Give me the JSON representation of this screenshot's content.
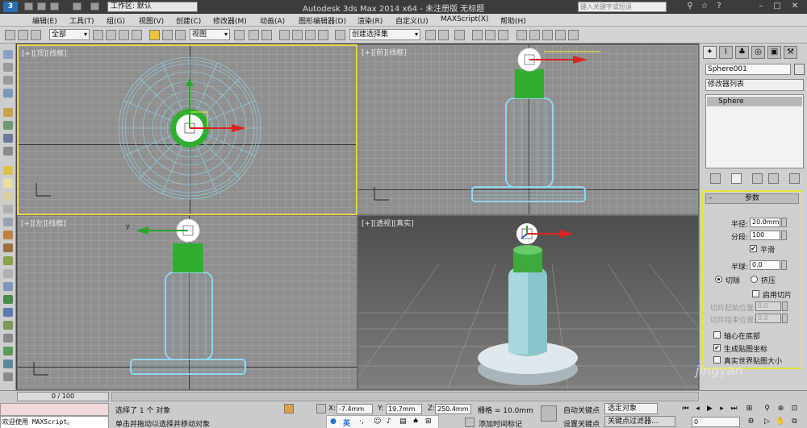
{
  "titlebar": {
    "workspace": "工作区: 默认",
    "title": "Autodesk 3ds Max  2014 x64    - 未注册版    无标题",
    "search_placeholder": "键入关键字或短语"
  },
  "menu": [
    "编辑(E)",
    "工具(T)",
    "组(G)",
    "视图(V)",
    "创建(C)",
    "修改器(M)",
    "动画(A)",
    "图形编辑器(D)",
    "渲染(R)",
    "自定义(U)",
    "MAXScript(X)",
    "帮助(H)"
  ],
  "toolbar": {
    "selection_filter": "全部",
    "ref_coord": "视图",
    "named_selection": "创建选择集"
  },
  "viewports": {
    "top": "[+][顶][线框]",
    "front": "[+][前][线框]",
    "left": "[+][左][线框]",
    "persp": "[+][透视][真实]"
  },
  "command_panel": {
    "object_name": "Sphere001",
    "modifier_list": "修改器列表",
    "stack_item": "Sphere",
    "rollout_title": "参数",
    "radius_label": "半径:",
    "radius_value": "20.0mm",
    "segments_label": "分段:",
    "segments_value": "100",
    "smooth_label": "平滑",
    "hemisphere_label": "半球:",
    "hemisphere_value": "0.0",
    "chop_label": "切除",
    "squash_label": "挤压",
    "enable_slice_label": "启用切片",
    "slice_from_label": "切片起始位置:",
    "slice_from_value": "0.0",
    "slice_to_label": "切片结束位置:",
    "slice_to_value": "0.0",
    "base_to_pivot_label": "轴心在底部",
    "gen_mapping_label": "生成贴图坐标",
    "real_world_label": "真实世界贴图大小"
  },
  "status": {
    "frame_counter": "0 / 100",
    "selected": "选择了 1 个 对象",
    "prompt": "单击并拖动以选择并移动对象",
    "maxscript": "欢迎使用 MAXScript。",
    "x_label": "X:",
    "x_value": "-7.4mm",
    "y_label": "Y:",
    "y_value": "19.7mm",
    "z_label": "Z:",
    "z_value": "250.4mm",
    "grid": "栅格 = 10.0mm",
    "add_time_tag": "添加时间标记",
    "auto_key": "自动关键点",
    "set_key": "设置关键点",
    "selected_obj": "选定对象",
    "key_filters": "关键点过滤器...",
    "frame_value": "0",
    "ime_label": "英"
  },
  "colors": {
    "active_viewport_border": "#e8d94b",
    "wire_blue": "#7fd4f0",
    "green_cap": "#2fae2f"
  },
  "watermark": "jingyan"
}
